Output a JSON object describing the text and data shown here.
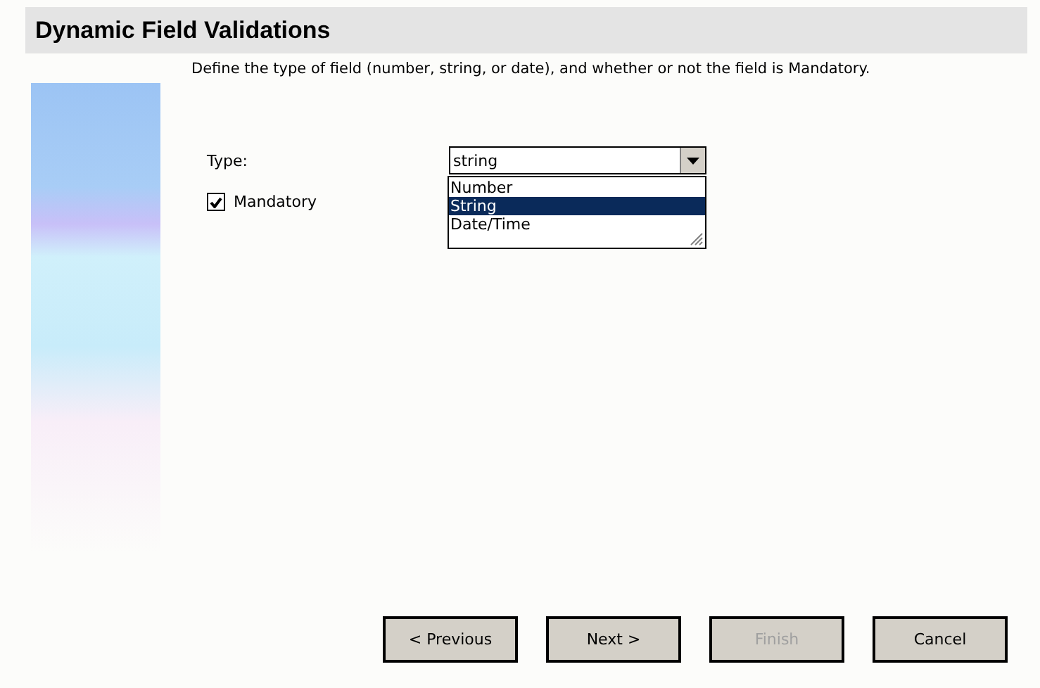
{
  "title": "Dynamic Field Validations",
  "description": "Define the type of field (number, string, or date), and whether or not the field is Mandatory.",
  "type_field": {
    "label": "Type:",
    "value": "string",
    "expanded": true,
    "options": [
      {
        "label": "Number",
        "selected": false
      },
      {
        "label": "String",
        "selected": true
      },
      {
        "label": "Date/Time",
        "selected": false
      }
    ]
  },
  "mandatory": {
    "label": "Mandatory",
    "checked": true
  },
  "buttons": [
    {
      "label": "< Previous",
      "disabled": false
    },
    {
      "label": "Next >",
      "disabled": false
    },
    {
      "label": "Finish",
      "disabled": true
    },
    {
      "label": "Cancel",
      "disabled": false
    }
  ]
}
